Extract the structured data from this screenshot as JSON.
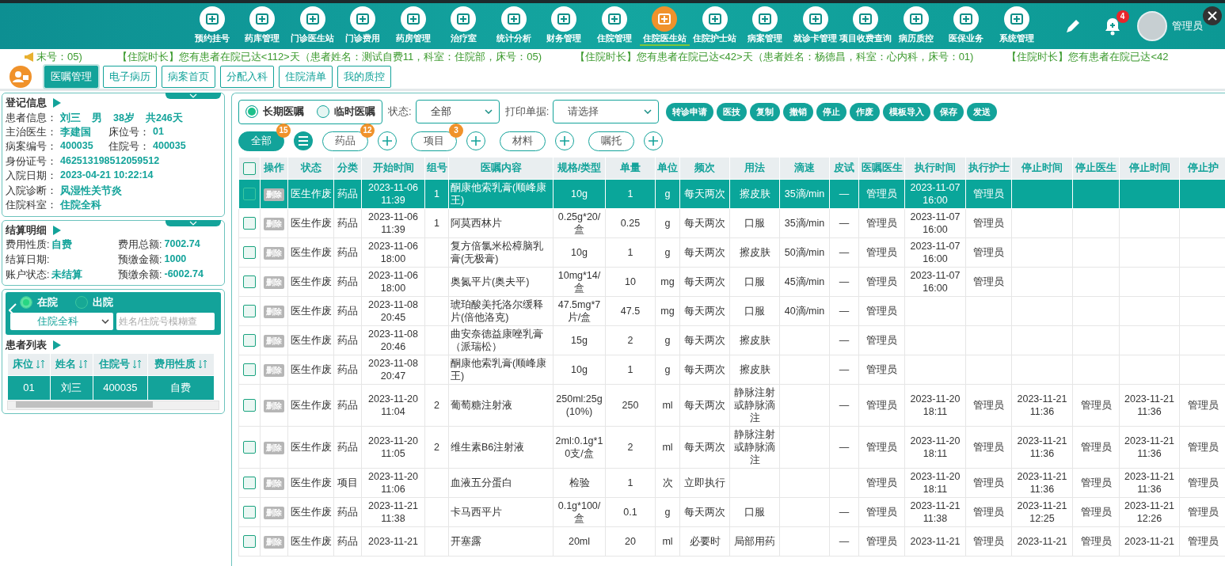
{
  "nav": {
    "items": [
      {
        "label": "预约挂号",
        "selected": false
      },
      {
        "label": "药库管理",
        "selected": false
      },
      {
        "label": "门诊医生站",
        "selected": false
      },
      {
        "label": "门诊费用",
        "selected": false
      },
      {
        "label": "药房管理",
        "selected": false
      },
      {
        "label": "治疗室",
        "selected": false
      },
      {
        "label": "统计分析",
        "selected": false
      },
      {
        "label": "财务管理",
        "selected": false
      },
      {
        "label": "住院管理",
        "selected": false
      },
      {
        "label": "住院医生站",
        "selected": true
      },
      {
        "label": "住院护士站",
        "selected": false
      },
      {
        "label": "病案管理",
        "selected": false
      },
      {
        "label": "就诊卡管理",
        "selected": false
      },
      {
        "label": "项目收费查询",
        "selected": false
      },
      {
        "label": "病历质控",
        "selected": false
      },
      {
        "label": "医保业务",
        "selected": false
      },
      {
        "label": "系统管理",
        "selected": false
      }
    ],
    "notifications": "4",
    "user": "管理员"
  },
  "ticker": [
    "末号：05)",
    "【住院时长】您有患者在院已达<112>天（患者姓名：测试自费11，科室：住院部，床号：05)",
    "【住院时长】您有患者在院已达<42>天（患者姓名：杨德昌，科室：心内科，床号：01)",
    "【住院时长】您有患者在院已达<42"
  ],
  "tabs": [
    {
      "label": "医嘱管理",
      "selected": true
    },
    {
      "label": "电子病历",
      "selected": false
    },
    {
      "label": "病案首页",
      "selected": false
    },
    {
      "label": "分配入科",
      "selected": false
    },
    {
      "label": "住院清单",
      "selected": false
    },
    {
      "label": "我的质控",
      "selected": false
    }
  ],
  "registration": {
    "title": "登记信息",
    "lines": [
      [
        {
          "label": "患者信息：",
          "values": [
            "刘三",
            "男",
            "38岁",
            "共246天"
          ]
        }
      ],
      [
        {
          "label": "主治医生：",
          "values": [
            "李建国"
          ]
        },
        {
          "label": "床位号：",
          "values": [
            "01"
          ]
        }
      ],
      [
        {
          "label": "病案编号：",
          "values": [
            "400035"
          ]
        },
        {
          "label": "住院号：",
          "values": [
            "400035"
          ]
        }
      ],
      [
        {
          "label": "身份证号：",
          "values": [
            "462513198512059512"
          ]
        }
      ],
      [
        {
          "label": "入院日期：",
          "values": [
            "2023-04-21 10:22:14"
          ]
        }
      ],
      [
        {
          "label": "入院诊断：",
          "values": [
            "风湿性关节炎"
          ]
        }
      ],
      [
        {
          "label": "住院科室：",
          "values": [
            "住院全科"
          ]
        }
      ]
    ]
  },
  "billing": {
    "title": "结算明细",
    "fields": [
      {
        "label": "费用性质:",
        "value": "自费"
      },
      {
        "label": "费用总额:",
        "value": "7002.74"
      },
      {
        "label": "结算日期:"
      },
      {
        "label": "预缴金额:",
        "value": "1000"
      },
      {
        "label": "账户状态:",
        "value": "未结算"
      },
      {
        "label": "预缴余额:",
        "value": "-6002.74"
      }
    ]
  },
  "patient_filter": {
    "status": [
      {
        "label": "在院",
        "selected": true
      },
      {
        "label": "出院",
        "selected": false
      }
    ],
    "department": "住院全科",
    "search": {
      "placeholder": "姓名/住院号模糊查"
    }
  },
  "patient_list": {
    "title": "患者列表",
    "columns": [
      "床位",
      "姓名",
      "住院号",
      "费用性质"
    ],
    "rows": [
      {
        "cells": [
          "01",
          "刘三",
          "400035",
          "自费"
        ],
        "selected": true
      }
    ]
  },
  "orders": {
    "type_options": [
      {
        "label": "长期医嘱",
        "selected": true
      },
      {
        "label": "临时医嘱",
        "selected": false
      }
    ],
    "status_label": "状态:",
    "status_value": "全部",
    "print_label": "打印单据:",
    "print_placeholder": "请选择",
    "actions": [
      "转诊申请",
      "医技",
      "复制",
      "撤销",
      "停止",
      "作废",
      "模板导入",
      "保存",
      "发送"
    ],
    "filters": [
      {
        "label": "全部",
        "count": "15",
        "selected": true,
        "kind": "all"
      },
      {
        "label": "药品",
        "count": "12",
        "selected": false,
        "kind": "category"
      },
      {
        "label": "项目",
        "count": "3",
        "selected": false,
        "kind": "category"
      },
      {
        "label": "材料",
        "selected": false,
        "kind": "category"
      },
      {
        "label": "嘱托",
        "selected": false,
        "kind": "category"
      }
    ],
    "table": {
      "all_checked": false,
      "action_header": "操作",
      "columns": [
        "状态",
        "分类",
        "开始时间",
        "组号",
        "医嘱内容",
        "规格/类型",
        "单量",
        "单位",
        "频次",
        "用法",
        "滴速",
        "皮试",
        "医嘱医生",
        "执行时间",
        "执行护士",
        "停止时间",
        "停止医生",
        "停止时间",
        "停止护"
      ],
      "rows": [
        {
          "selected": true,
          "checked": false,
          "action": "删除",
          "cells": [
            "医生作废",
            "药品",
            "2023-11-06 11:39",
            "1",
            "酮康他索乳膏(顺峰康王)",
            "10g",
            "1",
            "g",
            "每天两次",
            "擦皮肤",
            "35滴/min",
            "—",
            "管理员",
            "2023-11-07 16:00",
            "管理员",
            null,
            null,
            null,
            null
          ]
        },
        {
          "selected": false,
          "checked": false,
          "action": "删除",
          "cells": [
            "医生作废",
            "药品",
            "2023-11-06 11:39",
            "1",
            "阿莫西林片",
            "0.25g*20/盒",
            "0.25",
            "g",
            "每天两次",
            "口服",
            "35滴/min",
            "—",
            "管理员",
            "2023-11-07 16:00",
            "管理员",
            null,
            null,
            null,
            null
          ]
        },
        {
          "selected": false,
          "checked": false,
          "action": "删除",
          "cells": [
            "医生作废",
            "药品",
            "2023-11-06 18:00",
            null,
            "复方倍氯米松樟脑乳膏(无极膏)",
            "10g",
            "1",
            "g",
            "每天两次",
            "擦皮肤",
            "50滴/min",
            "—",
            "管理员",
            "2023-11-07 16:00",
            "管理员",
            null,
            null,
            null,
            null
          ]
        },
        {
          "selected": false,
          "checked": false,
          "action": "删除",
          "cells": [
            "医生作废",
            "药品",
            "2023-11-06 18:00",
            null,
            "奥氮平片(奥夫平)",
            "10mg*14/盒",
            "10",
            "mg",
            "每天两次",
            "口服",
            "45滴/min",
            "—",
            "管理员",
            "2023-11-07 16:00",
            "管理员",
            null,
            null,
            null,
            null
          ]
        },
        {
          "selected": false,
          "checked": false,
          "action": "删除",
          "cells": [
            "医生作废",
            "药品",
            "2023-11-08 20:45",
            null,
            "琥珀酸美托洛尔缓释片(倍他洛克)",
            "47.5mg*7片/盒",
            "47.5",
            "mg",
            "每天两次",
            "口服",
            "40滴/min",
            "—",
            "管理员",
            null,
            null,
            null,
            null,
            null,
            null
          ]
        },
        {
          "selected": false,
          "checked": false,
          "action": "删除",
          "cells": [
            "医生作废",
            "药品",
            "2023-11-08 20:46",
            null,
            "曲安奈德益康唑乳膏（派瑞松）",
            "15g",
            "2",
            "g",
            "每天两次",
            "擦皮肤",
            null,
            "—",
            "管理员",
            null,
            null,
            null,
            null,
            null,
            null
          ]
        },
        {
          "selected": false,
          "checked": false,
          "action": "删除",
          "cells": [
            "医生作废",
            "药品",
            "2023-11-08 20:47",
            null,
            "酮康他索乳膏(顺峰康王)",
            "10g",
            "1",
            "g",
            "每天两次",
            "擦皮肤",
            null,
            "—",
            "管理员",
            null,
            null,
            null,
            null,
            null,
            null
          ]
        },
        {
          "selected": false,
          "checked": false,
          "action": "删除",
          "cells": [
            "医生作废",
            "药品",
            "2023-11-20 11:04",
            "2",
            "葡萄糖注射液",
            "250ml:25g(10%)",
            "250",
            "ml",
            "每天两次",
            "静脉注射或静脉滴注",
            null,
            "—",
            "管理员",
            "2023-11-20 18:11",
            "管理员",
            "2023-11-21 11:36",
            "管理员",
            "2023-11-21 11:36",
            "管理员"
          ]
        },
        {
          "selected": false,
          "checked": false,
          "action": "删除",
          "cells": [
            "医生作废",
            "药品",
            "2023-11-20 11:05",
            "2",
            "维生素B6注射液",
            "2ml:0.1g*10支/盒",
            "2",
            "ml",
            "每天两次",
            "静脉注射或静脉滴注",
            null,
            "—",
            "管理员",
            "2023-11-20 18:11",
            "管理员",
            "2023-11-21 11:36",
            "管理员",
            "2023-11-21 11:36",
            "管理员"
          ]
        },
        {
          "selected": false,
          "checked": false,
          "action": "删除",
          "cells": [
            "医生作废",
            "项目",
            "2023-11-20 11:06",
            null,
            "血液五分蛋白",
            "检验",
            "1",
            "次",
            "立即执行",
            null,
            null,
            null,
            "管理员",
            "2023-11-20 18:11",
            "管理员",
            "2023-11-21 11:36",
            "管理员",
            "2023-11-21 11:36",
            "管理员"
          ]
        },
        {
          "selected": false,
          "checked": false,
          "action": "删除",
          "cells": [
            "医生作废",
            "药品",
            "2023-11-21 11:38",
            null,
            "卡马西平片",
            "0.1g*100/盒",
            "0.1",
            "g",
            "每天两次",
            "口服",
            null,
            "—",
            "管理员",
            "2023-11-21 11:38",
            "管理员",
            "2023-11-21 12:25",
            "管理员",
            "2023-11-21 12:26",
            "管理员"
          ]
        },
        {
          "selected": false,
          "checked": false,
          "action": "删除",
          "cells": [
            "医生作废",
            "药品",
            "2023-11-21",
            null,
            "开塞露",
            "20ml",
            "20",
            "ml",
            "必要时",
            "局部用药",
            null,
            "—",
            "管理员",
            "2023-11-21",
            "管理员",
            "2023-11-21",
            "管理员",
            "2023-11-21",
            "管理员"
          ]
        }
      ]
    }
  }
}
